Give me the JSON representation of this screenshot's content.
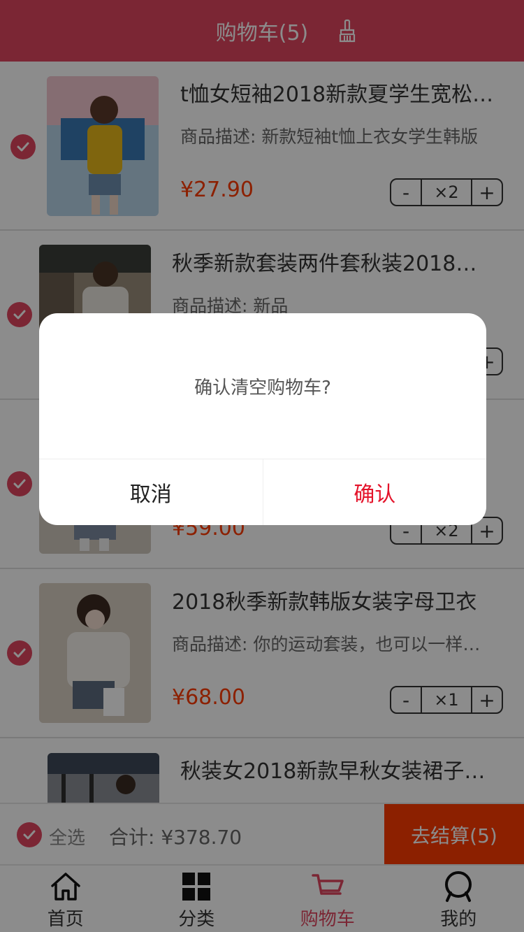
{
  "header": {
    "title": "购物车(5)"
  },
  "items": [
    {
      "title": "t恤女短袖2018新款夏学生宽松韩版",
      "desc": "商品描述: 新款短袖t恤上衣女学生韩版",
      "price": "¥27.90",
      "minus": "-",
      "qty": "×2",
      "plus": "+"
    },
    {
      "title": "秋季新款套装两件套秋装2018韩版",
      "desc": "商品描述: 新品",
      "price": "",
      "minus": "-",
      "qty": "",
      "plus": "+"
    },
    {
      "title": "",
      "desc": "",
      "price": "¥59.00",
      "minus": "-",
      "qty": "×2",
      "plus": "+"
    },
    {
      "title": "2018秋季新款韩版女装字母卫衣",
      "desc": "商品描述: 你的运动套装，也可以一样时尚",
      "price": "¥68.00",
      "minus": "-",
      "qty": "×1",
      "plus": "+"
    },
    {
      "title": "秋装女2018新款早秋女装裙子连衣裙",
      "desc": "",
      "price": "",
      "minus": "-",
      "qty": "",
      "plus": "+"
    }
  ],
  "footer": {
    "select_all": "全选",
    "total": "合计: ¥378.70",
    "checkout": "去结算(5)"
  },
  "tabs": [
    {
      "label": "首页",
      "icon": "home-icon"
    },
    {
      "label": "分类",
      "icon": "category-grid-icon"
    },
    {
      "label": "购物车",
      "icon": "cart-icon"
    },
    {
      "label": "我的",
      "icon": "profile-icon"
    }
  ],
  "dialog": {
    "message": "确认清空购物车?",
    "cancel": "取消",
    "confirm": "确认"
  },
  "colors": {
    "brand": "#e0465f",
    "price": "#ff3b00",
    "checkout_bg": "#ff3b00",
    "confirm_text": "#e4132a"
  }
}
